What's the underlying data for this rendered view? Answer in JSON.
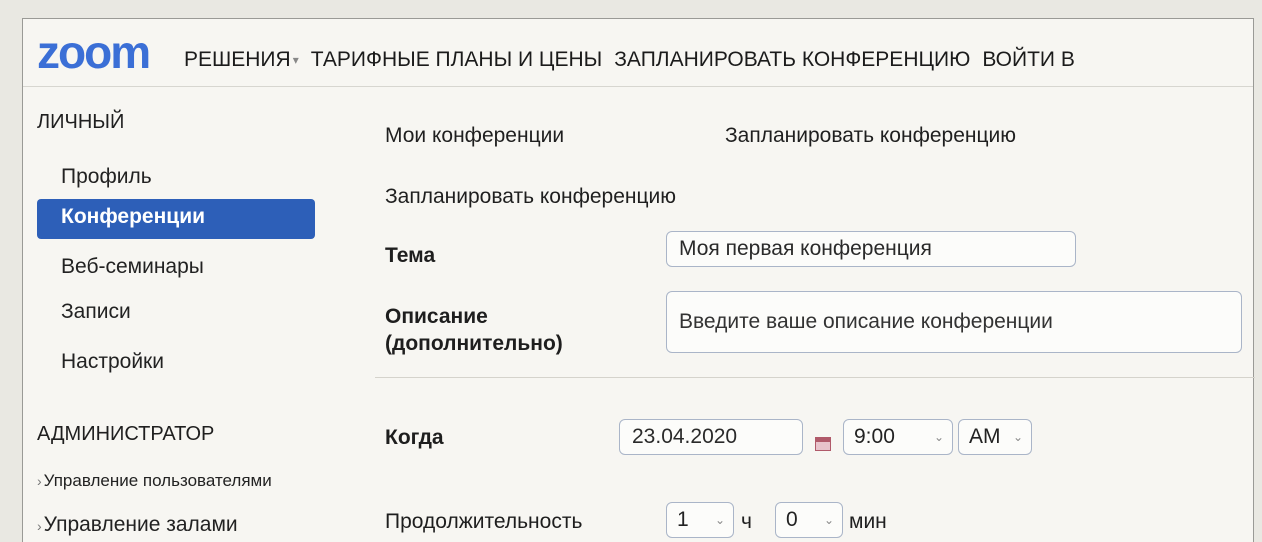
{
  "header": {
    "logo": "zoom",
    "nav": {
      "solutions": "РЕШЕНИЯ",
      "plans": "ТАРИФНЫЕ ПЛАНЫ И ЦЕНЫ",
      "schedule": "ЗАПЛАНИРОВАТЬ КОНФЕРЕНЦИЮ",
      "signin": "ВОЙТИ В"
    }
  },
  "sidebar": {
    "personal_heading": "ЛИЧНЫЙ",
    "items": [
      "Профиль",
      "Конференции",
      "Веб-семинары",
      "Записи",
      "Настройки"
    ],
    "active_index": 1,
    "admin_heading": "АДМИНИСТРАТОР",
    "admin_items": [
      "Управление пользователями",
      "Управление залами"
    ]
  },
  "main": {
    "tabs": [
      "Мои конференции",
      "Запланировать конференцию"
    ],
    "section_title": "Запланировать конференцию",
    "topic": {
      "label": "Тема",
      "value": "Моя первая конференция"
    },
    "description": {
      "label_line1": "Описание",
      "label_line2": "(дополнительно)",
      "placeholder": "Введите ваше описание конференции"
    },
    "when": {
      "label": "Когда",
      "date": "23.04.2020",
      "time": "9:00",
      "ampm": "AM"
    },
    "duration": {
      "label": "Продолжительность",
      "hours": "1",
      "hours_unit": "ч",
      "minutes": "0",
      "minutes_unit": "мин"
    }
  },
  "colors": {
    "brand": "#3b6fd6",
    "active_bg": "#2d5fb8",
    "background": "#f7f6f2"
  }
}
